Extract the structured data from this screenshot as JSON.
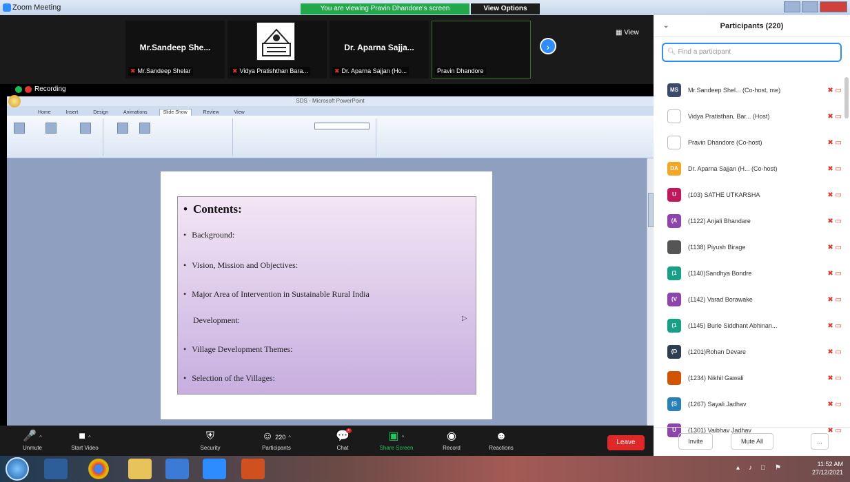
{
  "window": {
    "title": "Zoom Meeting"
  },
  "banner": {
    "viewing": "You are viewing Pravin Dhandore's screen",
    "view_options": "View Options"
  },
  "tiles": [
    {
      "name": "Mr.Sandeep She...",
      "label": "Mr.Sandeep Shelar"
    },
    {
      "name": "",
      "label": "Vidya Pratishthan Bara..."
    },
    {
      "name": "Dr. Aparna Sajja...",
      "label": "Dr. Aparna Sajjan (Ho..."
    },
    {
      "name": "",
      "label": "Pravin Dhandore"
    }
  ],
  "view_btn": "View",
  "recording": "Recording",
  "ppt": {
    "title": "SDS - Microsoft PowerPoint",
    "tabs": [
      "Home",
      "Insert",
      "Design",
      "Animations",
      "Slide Show",
      "Review",
      "View"
    ],
    "active_tab": "Slide Show"
  },
  "slide": {
    "heading": "Contents:",
    "items": [
      "Background:",
      "Vision, Mission and Objectives:",
      "Major Area of Intervention in Sustainable  Rural India",
      "Development:",
      "Village Development Themes:",
      "Selection of the Villages:"
    ]
  },
  "toolbar": {
    "unmute": "Unmute",
    "start_video": "Start Video",
    "security": "Security",
    "participants": "Participants",
    "participants_count": "220",
    "chat": "Chat",
    "share_screen": "Share Screen",
    "record": "Record",
    "reactions": "Reactions",
    "leave": "Leave"
  },
  "panel": {
    "title": "Participants (220)",
    "search_placeholder": "Find a participant",
    "participants": [
      {
        "initials": "MS",
        "color": "#3a4a6b",
        "name": "Mr.Sandeep Shel... (Co-host, me)"
      },
      {
        "initials": "",
        "color": "#ffffff",
        "name": "Vidya Pratisthan, Bar... (Host)"
      },
      {
        "initials": "",
        "color": "#ffffff",
        "name": "Pravin Dhandore (Co-host)"
      },
      {
        "initials": "DA",
        "color": "#f5a623",
        "name": "Dr. Aparna Sajjan (H... (Co-host)"
      },
      {
        "initials": "U",
        "color": "#c2185b",
        "name": "(103) SATHE UTKARSHA"
      },
      {
        "initials": "(A",
        "color": "#8e44ad",
        "name": "(1122) Anjali Bhandare"
      },
      {
        "initials": "",
        "color": "#555555",
        "name": "(1138) Piyush Birage"
      },
      {
        "initials": "(1",
        "color": "#16a085",
        "name": "(1140)Sandhya Bondre"
      },
      {
        "initials": "(V",
        "color": "#8e44ad",
        "name": "(1142) Varad Borawake"
      },
      {
        "initials": "(1",
        "color": "#16a085",
        "name": "(1145) Burle Siddhant Abhinan..."
      },
      {
        "initials": "(D",
        "color": "#2c3e50",
        "name": "(1201)Rohan Devare"
      },
      {
        "initials": "",
        "color": "#d35400",
        "name": "(1234) Nikhil Gawali"
      },
      {
        "initials": "(S",
        "color": "#2980b9",
        "name": "(1267) Sayali Jadhav"
      },
      {
        "initials": "U",
        "color": "#8e44ad",
        "name": "(1301) Vaibhav Jadhav"
      }
    ],
    "invite": "Invite",
    "mute_all": "Mute All",
    "more": "..."
  },
  "tray": {
    "time": "11:52 AM",
    "date": "27/12/2021"
  }
}
